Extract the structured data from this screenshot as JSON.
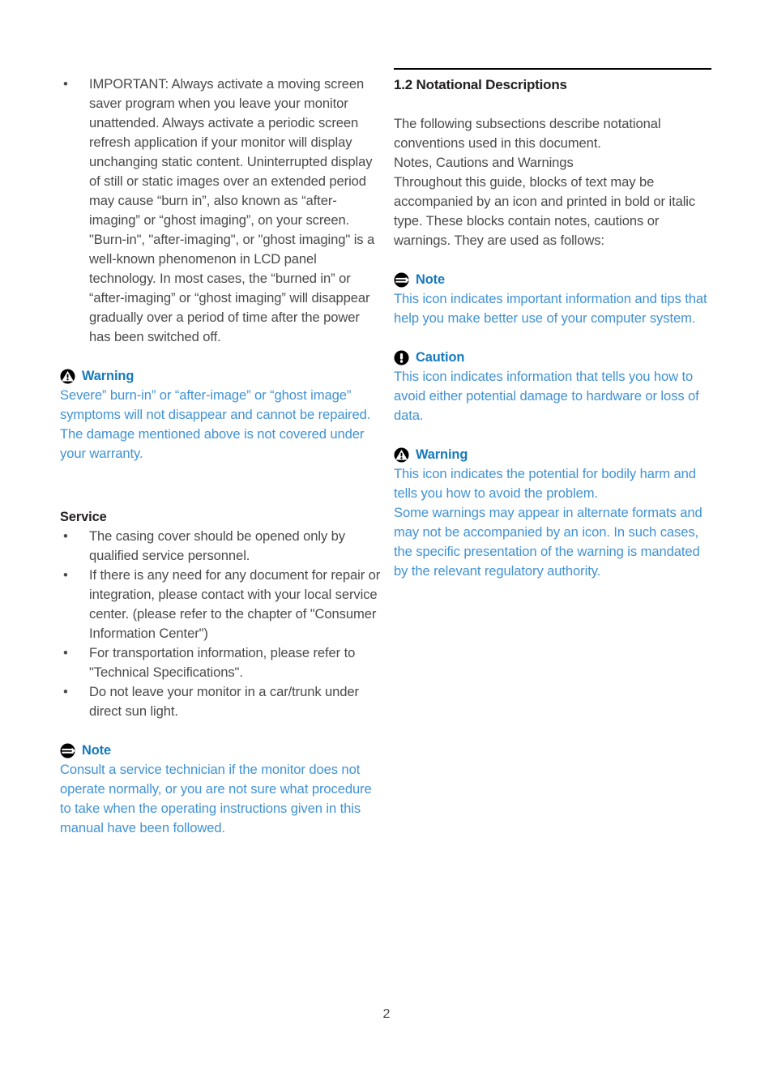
{
  "page": {
    "number": "2"
  },
  "left_column": {
    "important_bullet": {
      "bullet_glyph": "•",
      "text": "IMPORTANT: Always activate a moving screen saver program when you leave your monitor unattended. Always activate a periodic screen refresh application if your monitor will display unchanging static content. Uninterrupted display of still or static images over an extended period may cause “burn in”, also known as “after-imaging” or “ghost imaging”,  on your screen. \"Burn-in\", \"after-imaging\", or \"ghost imaging\" is a well-known phenomenon in LCD panel technology. In most cases, the “burned in” or “after-imaging” or “ghost imaging” will disappear gradually over a period of time after the power has been switched off."
    },
    "warning_notice": {
      "icon": "warning-triangle-icon",
      "title": "Warning",
      "body": "Severe” burn-in” or “after-image” or “ghost image” symptoms will not disappear and cannot be repaired. The damage mentioned above is not covered under your warranty."
    },
    "service_section": {
      "heading": "Service",
      "bullet_glyph": "•",
      "items": [
        "The casing cover should be opened only by qualified service personnel.",
        "If there is any need for any document for repair or integration, please contact with your local service center. (please refer to the chapter of \"Consumer Information Center\")",
        "For transportation information, please refer to \"Technical Specifications\".",
        "Do not leave your monitor in a car/trunk under direct sun light."
      ]
    },
    "note_notice": {
      "icon": "note-lines-icon",
      "title": "Note",
      "body": "Consult a service technician if the monitor does not operate normally, or you are not sure what procedure to take when the operating instructions given in this manual have been followed."
    }
  },
  "right_column": {
    "chapter_heading": "1.2 Notational Descriptions",
    "intro_paragraph_1": "The following subsections describe notational conventions used in this document.",
    "intro_paragraph_2": "Notes, Cautions and Warnings",
    "intro_paragraph_3": "Throughout this guide, blocks of text may be accompanied by an icon and printed in bold or italic type. These blocks contain notes, cautions or warnings. They are used as follows:",
    "note_notice": {
      "icon": "note-lines-icon",
      "title": "Note",
      "body": "This icon indicates important information and tips that help you make better use of your computer system."
    },
    "caution_notice": {
      "icon": "caution-exclamation-icon",
      "title": "Caution",
      "body": "This icon indicates information that tells you how to avoid either potential damage to hardware or loss of data."
    },
    "warning_notice": {
      "icon": "warning-triangle-icon",
      "title": "Warning",
      "body_1": "This icon indicates the potential for bodily harm and tells you how to avoid the problem.",
      "body_2": "Some warnings may appear in alternate formats and may not be accompanied by an icon. In such cases, the specific presentation of the warning is mandated by the relevant regulatory authority."
    }
  },
  "colors": {
    "heading_blue": "#1579bf",
    "body_blue": "#4092d4",
    "body_gray": "#4a4a4a",
    "rule_black": "#000000"
  }
}
